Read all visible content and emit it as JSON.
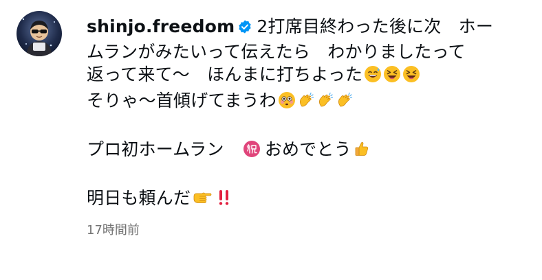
{
  "comment": {
    "username": "shinjo.freedom",
    "verified_icon": "verified-badge-icon",
    "lines": [
      "2打席目終わった後に次　ホー",
      "ムランがみたいって伝えたら　わかりましたって",
      "返って来て〜　ほんまに打ちよった",
      "そりゃ〜首傾げてまうわ",
      "プロ初ホームラン　",
      "おめでとう",
      "明日も頼んだ"
    ],
    "emojis": {
      "line3": [
        "grinning-sweat-emoji",
        "laughing-squint-emoji",
        "laughing-squint-emoji"
      ],
      "line4": [
        "flushed-face-emoji",
        "clapping-hands-emoji",
        "clapping-hands-emoji",
        "clapping-hands-emoji"
      ],
      "line5": [
        "congratulations-ideograph-emoji"
      ],
      "line6": [
        "thumbs-up-emoji"
      ],
      "line7": [
        "pointing-fist-emoji",
        "double-exclamation-emoji"
      ]
    },
    "timestamp": "17時間前"
  },
  "colors": {
    "text": "#0c1014",
    "verified_blue": "#0095f6",
    "timestamp_gray": "#737373",
    "emoji_yellow": "#fbbf24",
    "congrats_pink": "#e0457b",
    "exclaim_red": "#e21f3f"
  }
}
